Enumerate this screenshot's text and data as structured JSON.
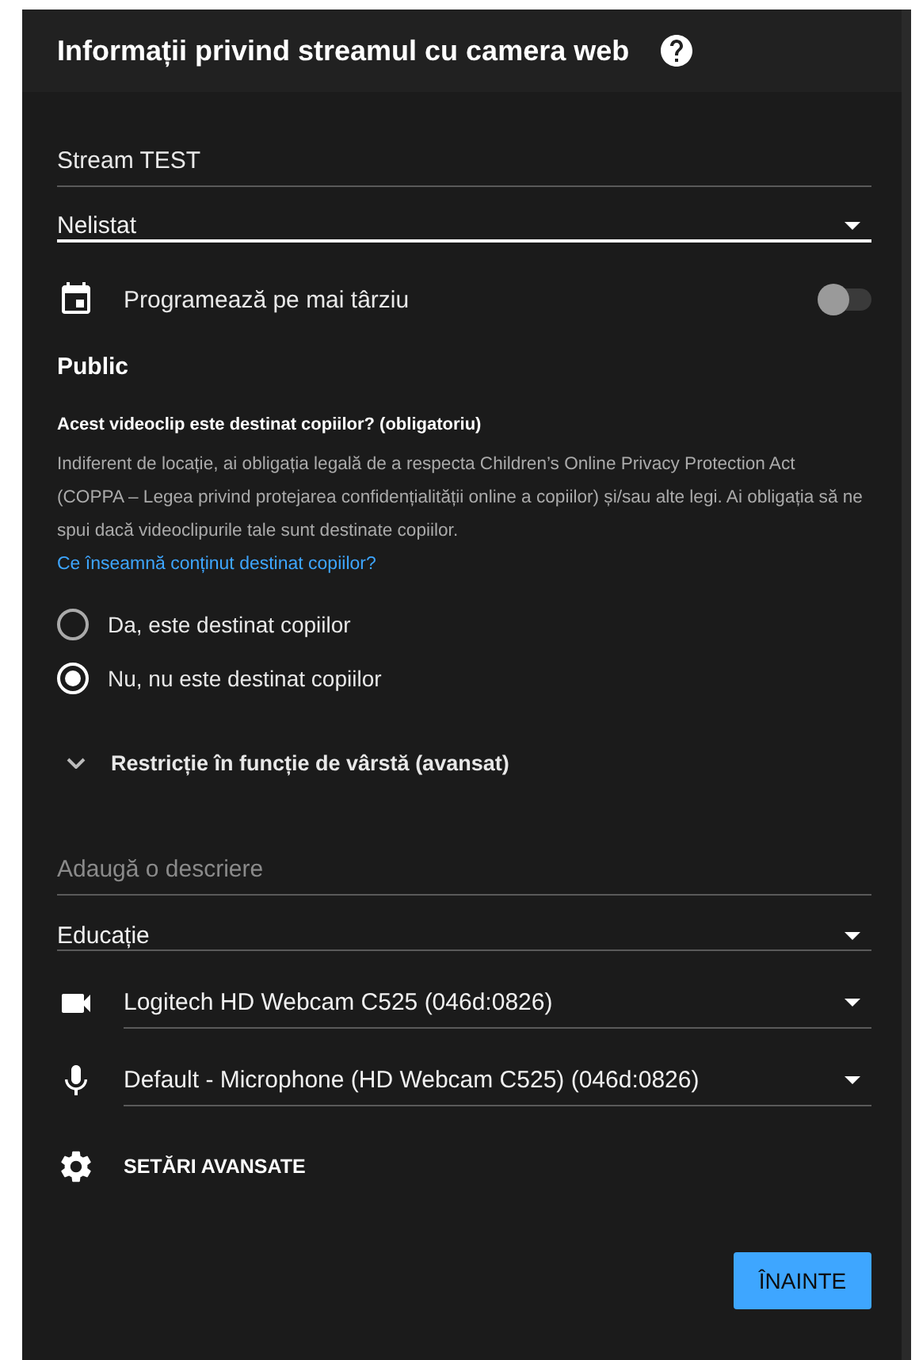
{
  "header": {
    "title": "Informații privind streamul cu camera web"
  },
  "title_field": {
    "value": "Stream TEST"
  },
  "visibility_select": {
    "value": "Nelistat",
    "focused": true
  },
  "schedule": {
    "label": "Programează pe mai târziu",
    "on": false
  },
  "audience": {
    "heading": "Public",
    "question": "Acest videoclip este destinat copiilor? (obligatoriu)",
    "description": "Indiferent de locație, ai obligația legală de a respecta Children’s Online Privacy Protection Act (COPPA – Legea privind protejarea confidențialității online a copiilor) și/sau alte legi. Ai obligația să ne spui dacă videoclipurile tale sunt destinate copiilor.",
    "link": "Ce înseamnă conținut destinat copiilor?",
    "options": [
      {
        "label": "Da, este destinat copiilor",
        "selected": false
      },
      {
        "label": "Nu, nu este destinat copiilor",
        "selected": true
      }
    ]
  },
  "age_restriction": {
    "label": "Restricție în funcție de vârstă (avansat)",
    "expanded": false
  },
  "description_field": {
    "placeholder": "Adaugă o descriere"
  },
  "selects": [
    {
      "kind": "plain",
      "value": "Educație"
    },
    {
      "kind": "camera",
      "value": "Logitech HD Webcam C525 (046d:0826)"
    },
    {
      "kind": "microphone",
      "value": "Default - Microphone (HD Webcam C525) (046d:0826)"
    }
  ],
  "advanced": {
    "label": "SETĂRI AVANSATE"
  },
  "next_button": {
    "label": "ÎNAINTE"
  }
}
